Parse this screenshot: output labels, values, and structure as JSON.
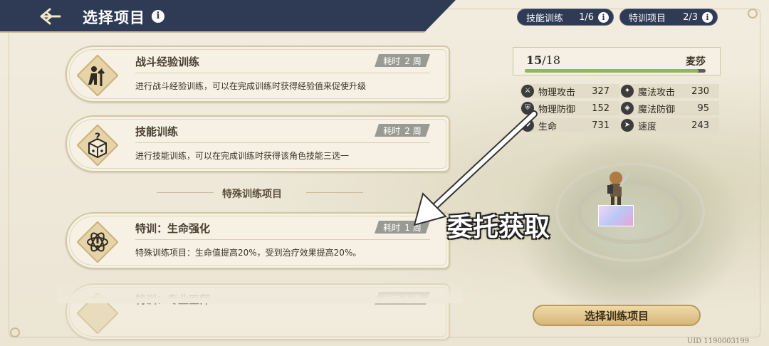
{
  "header": {
    "title": "选择项目",
    "back_icon": "back-arrow-icon",
    "info_icon_text": "i"
  },
  "counters": [
    {
      "label": "技能训练",
      "value": "1/6"
    },
    {
      "label": "特训项目",
      "value": "2/3"
    }
  ],
  "cards": [
    {
      "title": "战斗经验训练",
      "time_label": "耗时",
      "time_value": "2 周",
      "desc": "进行战斗经验训练，可以在完成训练时获得经验值来促使升级",
      "icon": "level-up-icon"
    },
    {
      "title": "技能训练",
      "time_label": "耗时",
      "time_value": "2 周",
      "desc": "进行技能训练，可以在完成训练时获得该角色技能三选一",
      "icon": "dice-question-icon"
    },
    {
      "title": "特训：生命强化",
      "time_label": "耗时",
      "time_value": "1 周",
      "desc": "特殊训练项目：生命值提高20%，受到治疗效果提高20%。",
      "icon": "atom-icon"
    },
    {
      "title": "特训：专业医师",
      "time_label": "耗时",
      "time_value": "1 周",
      "desc": "",
      "icon": "atom-icon"
    }
  ],
  "section_title": "特殊训练项目",
  "character": {
    "count_current": "15",
    "count_sep": "/",
    "count_total": "18",
    "name": "麦莎",
    "progress": 0.96
  },
  "stats": [
    {
      "label": "物理攻击",
      "value": "327",
      "icon": "sword-icon"
    },
    {
      "label": "魔法攻击",
      "value": "230",
      "icon": "wand-icon"
    },
    {
      "label": "物理防御",
      "value": "152",
      "icon": "shield-icon"
    },
    {
      "label": "魔法防御",
      "value": "95",
      "icon": "magic-shield-icon"
    },
    {
      "label": "生命",
      "value": "731",
      "icon": "heart-icon"
    },
    {
      "label": "速度",
      "value": "243",
      "icon": "boot-icon"
    }
  ],
  "select_button": "选择训练项目",
  "uid": "UID 1190003199",
  "annotation": "委托获取",
  "colors": {
    "header_bg": "#2f3a55",
    "progress": "#8fb85a",
    "button": "#d8b678"
  }
}
